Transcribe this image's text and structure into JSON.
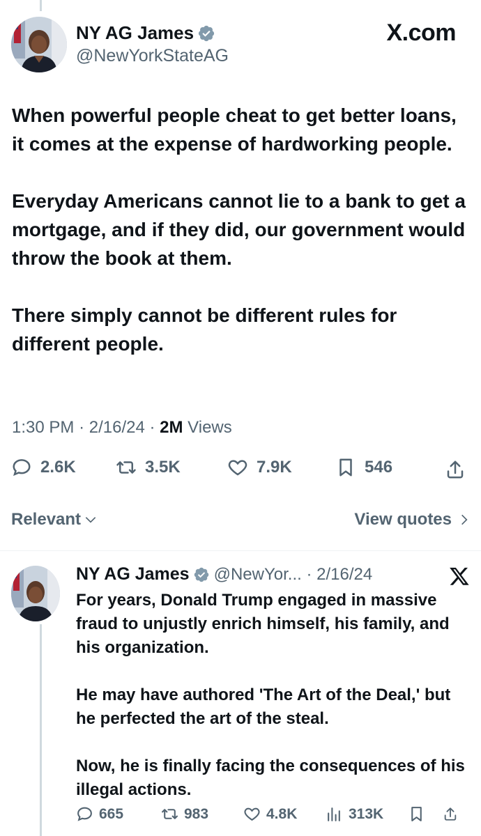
{
  "main_tweet": {
    "author_name": "NY AG James",
    "handle": "@NewYorkStateAG",
    "site_label": "X.com",
    "paragraphs": [
      "When powerful people cheat to get better loans, it comes at the expense of hardworking people.",
      "Everyday Americans cannot lie to a bank to get a mortgage, and if they did, our government would throw the book at them.",
      "There simply cannot be different rules for different people."
    ],
    "time": "1:30 PM",
    "date": "2/16/24",
    "views_count": "2M",
    "views_label": "Views",
    "stats": {
      "replies": "2.6K",
      "retweets": "3.5K",
      "likes": "7.9K",
      "bookmarks": "546"
    }
  },
  "sort": {
    "relevant_label": "Relevant",
    "view_quotes_label": "View quotes"
  },
  "quoted_tweet": {
    "author_name": "NY AG James",
    "handle_date": "@NewYor... · 2/16/24",
    "paragraphs": [
      "For years, Donald Trump engaged in massive fraud to unjustly enrich himself, his family, and his organization.",
      "He may have authored 'The Art of the Deal,' but he perfected the art of the steal.",
      "Now, he is finally facing the consequences of his illegal actions."
    ],
    "stats": {
      "replies": "665",
      "retweets": "983",
      "likes": "4.8K",
      "views": "313K"
    }
  },
  "colors": {
    "text": "#0f1419",
    "secondary": "#536471",
    "verified": "#829aab",
    "divider": "#eff3f4"
  }
}
